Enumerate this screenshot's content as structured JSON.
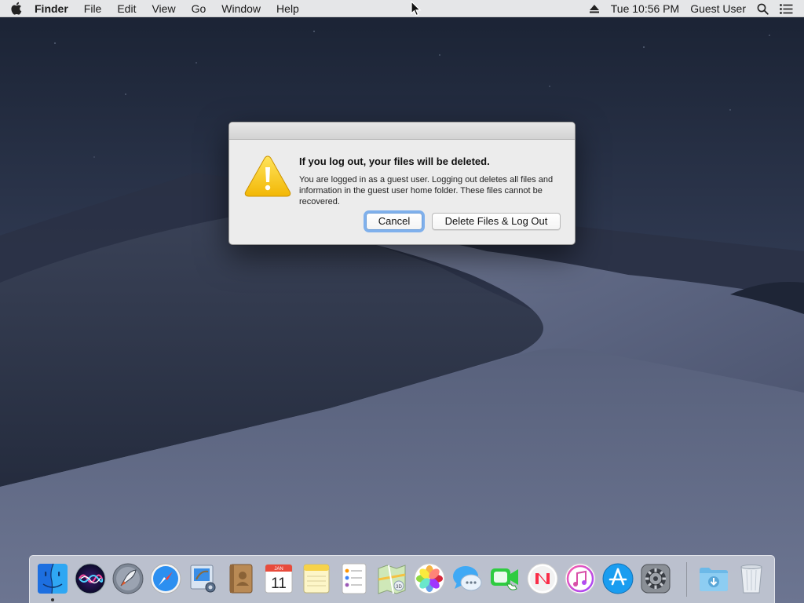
{
  "menubar": {
    "apple_icon": "apple-logo-icon",
    "app_name": "Finder",
    "menus": [
      "File",
      "Edit",
      "View",
      "Go",
      "Window",
      "Help"
    ],
    "status": {
      "eject_icon": "eject-icon",
      "clock": "Tue 10:56 PM",
      "user": "Guest User",
      "spotlight_icon": "search-icon",
      "notification_icon": "notification-center-icon"
    }
  },
  "alert": {
    "icon": "caution-triangle-icon",
    "title": "If you log out, your files will be deleted.",
    "message": "You are logged in as a guest user. Logging out deletes all files and information in the guest user home folder. These files cannot be recovered.",
    "cancel_label": "Cancel",
    "delete_label": "Delete Files & Log Out",
    "default_button_color": "#7fb0ec"
  },
  "dock": {
    "items": [
      {
        "name": "Finder",
        "icon": "finder-icon",
        "running": true
      },
      {
        "name": "Siri",
        "icon": "siri-icon"
      },
      {
        "name": "Launchpad",
        "icon": "launchpad-icon"
      },
      {
        "name": "Safari",
        "icon": "safari-icon"
      },
      {
        "name": "Mail",
        "icon": "mail-icon"
      },
      {
        "name": "Contacts",
        "icon": "contacts-icon"
      },
      {
        "name": "Calendar",
        "icon": "calendar-icon",
        "month": "JAN",
        "day": "11"
      },
      {
        "name": "Notes",
        "icon": "notes-icon"
      },
      {
        "name": "Reminders",
        "icon": "reminders-icon"
      },
      {
        "name": "Maps",
        "icon": "maps-icon"
      },
      {
        "name": "Photos",
        "icon": "photos-icon"
      },
      {
        "name": "Messages",
        "icon": "messages-icon"
      },
      {
        "name": "FaceTime",
        "icon": "facetime-icon"
      },
      {
        "name": "News",
        "icon": "news-icon"
      },
      {
        "name": "iTunes",
        "icon": "itunes-icon"
      },
      {
        "name": "App Store",
        "icon": "app-store-icon"
      },
      {
        "name": "System Preferences",
        "icon": "system-preferences-icon"
      },
      {
        "name": "Downloads",
        "icon": "downloads-folder-icon"
      },
      {
        "name": "Trash",
        "icon": "trash-icon"
      }
    ]
  }
}
